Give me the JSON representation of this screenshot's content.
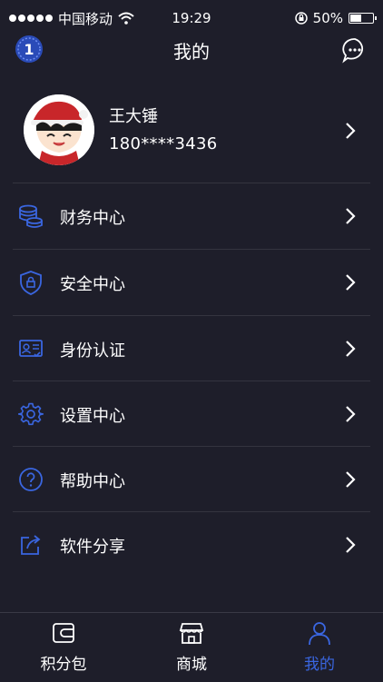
{
  "status_bar": {
    "carrier": "中国移动",
    "time": "19:29",
    "battery": "50%"
  },
  "header": {
    "title": "我的",
    "badge_icon": "medal-one-icon",
    "message_icon": "chat-bubble-icon"
  },
  "profile": {
    "name": "王大锤",
    "phone": "180****3436"
  },
  "menu": {
    "items": [
      {
        "label": "财务中心",
        "icon": "coins-stack-icon"
      },
      {
        "label": "安全中心",
        "icon": "shield-lock-icon"
      },
      {
        "label": "身份认证",
        "icon": "id-card-icon"
      },
      {
        "label": "设置中心",
        "icon": "gear-icon"
      },
      {
        "label": "帮助中心",
        "icon": "question-circle-icon"
      },
      {
        "label": "软件分享",
        "icon": "share-icon"
      }
    ]
  },
  "tabs": {
    "items": [
      {
        "label": "积分包",
        "icon": "wallet-icon"
      },
      {
        "label": "商城",
        "icon": "store-icon"
      },
      {
        "label": "我的",
        "icon": "user-icon"
      }
    ],
    "active": "我的"
  },
  "colors": {
    "background": "#1e1e2a",
    "accent": "#3a66e0",
    "divider": "#34343f"
  }
}
